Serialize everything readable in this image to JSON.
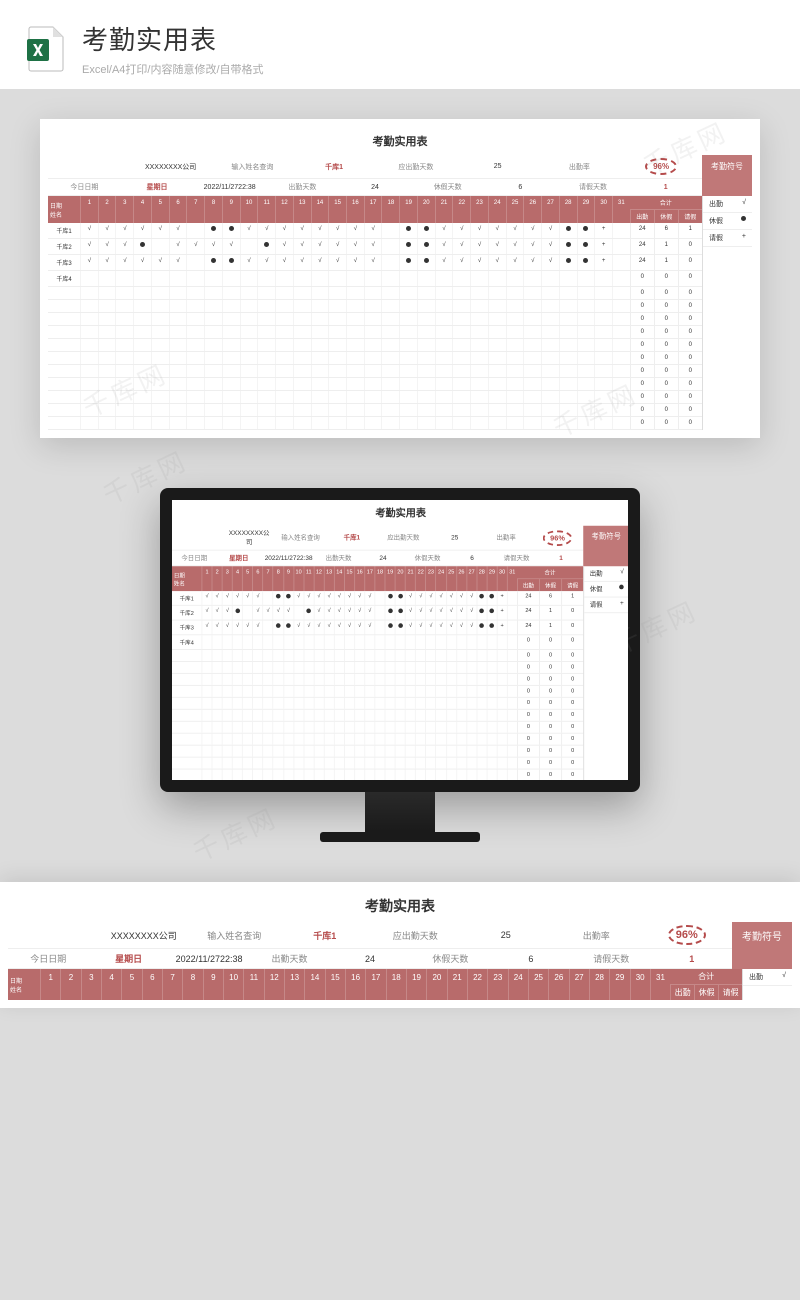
{
  "header": {
    "title": "考勤实用表",
    "subtitle": "Excel/A4打印/内容随意修改/自带格式"
  },
  "sheet": {
    "title": "考勤实用表",
    "info": {
      "company": "XXXXXXXX公司",
      "search_label": "输入姓名查询",
      "search_value": "千库1",
      "due_label": "应出勤天数",
      "due_value": "25",
      "rate_label": "出勤率",
      "rate_value": "96%",
      "today_label": "今日日期",
      "weekday": "星期日",
      "datetime": "2022/11/2722:38",
      "attend_label": "出勤天数",
      "attend_value": "24",
      "rest_label": "休假天数",
      "rest_value": "6",
      "leave_label": "请假天数",
      "leave_value": "1",
      "legend_title": "考勤符号"
    },
    "table": {
      "name_hdr_top": "日期",
      "name_hdr_bot": "姓名",
      "days": [
        "1",
        "2",
        "3",
        "4",
        "5",
        "6",
        "7",
        "8",
        "9",
        "10",
        "11",
        "12",
        "13",
        "14",
        "15",
        "16",
        "17",
        "18",
        "19",
        "20",
        "21",
        "22",
        "23",
        "24",
        "25",
        "26",
        "27",
        "28",
        "29",
        "30",
        "31"
      ],
      "sum_hdr": "合计",
      "sum_cols": [
        "出勤",
        "休假",
        "请假"
      ],
      "rows": [
        {
          "name": "千库1",
          "marks": [
            "√",
            "√",
            "√",
            "√",
            "√",
            "√",
            "",
            "●",
            "●",
            "√",
            "√",
            "√",
            "√",
            "√",
            "√",
            "√",
            "√",
            "",
            "●",
            "●",
            "√",
            "√",
            "√",
            "√",
            "√",
            "√",
            "√",
            "●",
            "●",
            "+",
            ""
          ],
          "sums": [
            "24",
            "6",
            "1"
          ]
        },
        {
          "name": "千库2",
          "marks": [
            "√",
            "√",
            "√",
            "●",
            "",
            "√",
            "√",
            "√",
            "√",
            "",
            "●",
            "√",
            "√",
            "√",
            "√",
            "√",
            "√",
            "",
            "●",
            "●",
            "√",
            "√",
            "√",
            "√",
            "√",
            "√",
            "√",
            "●",
            "●",
            "+",
            ""
          ],
          "sums": [
            "24",
            "1",
            "0"
          ]
        },
        {
          "name": "千库3",
          "marks": [
            "√",
            "√",
            "√",
            "√",
            "√",
            "√",
            "",
            "●",
            "●",
            "√",
            "√",
            "√",
            "√",
            "√",
            "√",
            "√",
            "√",
            "",
            "●",
            "●",
            "√",
            "√",
            "√",
            "√",
            "√",
            "√",
            "√",
            "●",
            "●",
            "+",
            ""
          ],
          "sums": [
            "24",
            "1",
            "0"
          ]
        },
        {
          "name": "千库4",
          "marks": [
            "",
            "",
            "",
            "",
            "",
            "",
            "",
            "",
            "",
            "",
            "",
            "",
            "",
            "",
            "",
            "",
            "",
            "",
            "",
            "",
            "",
            "",
            "",
            "",
            "",
            "",
            "",
            "",
            "",
            "",
            ""
          ],
          "sums": [
            "0",
            "0",
            "0"
          ]
        },
        {
          "name": "",
          "marks": [
            "",
            "",
            "",
            "",
            "",
            "",
            "",
            "",
            "",
            "",
            "",
            "",
            "",
            "",
            "",
            "",
            "",
            "",
            "",
            "",
            "",
            "",
            "",
            "",
            "",
            "",
            "",
            "",
            "",
            "",
            ""
          ],
          "sums": [
            "0",
            "0",
            "0"
          ]
        },
        {
          "name": "",
          "marks": [
            "",
            "",
            "",
            "",
            "",
            "",
            "",
            "",
            "",
            "",
            "",
            "",
            "",
            "",
            "",
            "",
            "",
            "",
            "",
            "",
            "",
            "",
            "",
            "",
            "",
            "",
            "",
            "",
            "",
            "",
            ""
          ],
          "sums": [
            "0",
            "0",
            "0"
          ]
        },
        {
          "name": "",
          "marks": [
            "",
            "",
            "",
            "",
            "",
            "",
            "",
            "",
            "",
            "",
            "",
            "",
            "",
            "",
            "",
            "",
            "",
            "",
            "",
            "",
            "",
            "",
            "",
            "",
            "",
            "",
            "",
            "",
            "",
            "",
            ""
          ],
          "sums": [
            "0",
            "0",
            "0"
          ]
        },
        {
          "name": "",
          "marks": [
            "",
            "",
            "",
            "",
            "",
            "",
            "",
            "",
            "",
            "",
            "",
            "",
            "",
            "",
            "",
            "",
            "",
            "",
            "",
            "",
            "",
            "",
            "",
            "",
            "",
            "",
            "",
            "",
            "",
            "",
            ""
          ],
          "sums": [
            "0",
            "0",
            "0"
          ]
        },
        {
          "name": "",
          "marks": [
            "",
            "",
            "",
            "",
            "",
            "",
            "",
            "",
            "",
            "",
            "",
            "",
            "",
            "",
            "",
            "",
            "",
            "",
            "",
            "",
            "",
            "",
            "",
            "",
            "",
            "",
            "",
            "",
            "",
            "",
            ""
          ],
          "sums": [
            "0",
            "0",
            "0"
          ]
        },
        {
          "name": "",
          "marks": [
            "",
            "",
            "",
            "",
            "",
            "",
            "",
            "",
            "",
            "",
            "",
            "",
            "",
            "",
            "",
            "",
            "",
            "",
            "",
            "",
            "",
            "",
            "",
            "",
            "",
            "",
            "",
            "",
            "",
            "",
            ""
          ],
          "sums": [
            "0",
            "0",
            "0"
          ]
        },
        {
          "name": "",
          "marks": [
            "",
            "",
            "",
            "",
            "",
            "",
            "",
            "",
            "",
            "",
            "",
            "",
            "",
            "",
            "",
            "",
            "",
            "",
            "",
            "",
            "",
            "",
            "",
            "",
            "",
            "",
            "",
            "",
            "",
            "",
            ""
          ],
          "sums": [
            "0",
            "0",
            "0"
          ]
        },
        {
          "name": "",
          "marks": [
            "",
            "",
            "",
            "",
            "",
            "",
            "",
            "",
            "",
            "",
            "",
            "",
            "",
            "",
            "",
            "",
            "",
            "",
            "",
            "",
            "",
            "",
            "",
            "",
            "",
            "",
            "",
            "",
            "",
            "",
            ""
          ],
          "sums": [
            "0",
            "0",
            "0"
          ]
        },
        {
          "name": "",
          "marks": [
            "",
            "",
            "",
            "",
            "",
            "",
            "",
            "",
            "",
            "",
            "",
            "",
            "",
            "",
            "",
            "",
            "",
            "",
            "",
            "",
            "",
            "",
            "",
            "",
            "",
            "",
            "",
            "",
            "",
            "",
            ""
          ],
          "sums": [
            "0",
            "0",
            "0"
          ]
        },
        {
          "name": "",
          "marks": [
            "",
            "",
            "",
            "",
            "",
            "",
            "",
            "",
            "",
            "",
            "",
            "",
            "",
            "",
            "",
            "",
            "",
            "",
            "",
            "",
            "",
            "",
            "",
            "",
            "",
            "",
            "",
            "",
            "",
            "",
            ""
          ],
          "sums": [
            "0",
            "0",
            "0"
          ]
        },
        {
          "name": "",
          "marks": [
            "",
            "",
            "",
            "",
            "",
            "",
            "",
            "",
            "",
            "",
            "",
            "",
            "",
            "",
            "",
            "",
            "",
            "",
            "",
            "",
            "",
            "",
            "",
            "",
            "",
            "",
            "",
            "",
            "",
            "",
            ""
          ],
          "sums": [
            "0",
            "0",
            "0"
          ]
        }
      ]
    },
    "legend": [
      {
        "label": "出勤",
        "mark": "√"
      },
      {
        "label": "休假",
        "mark": "●"
      },
      {
        "label": "请假",
        "mark": "+"
      }
    ]
  },
  "watermark": "千库网"
}
